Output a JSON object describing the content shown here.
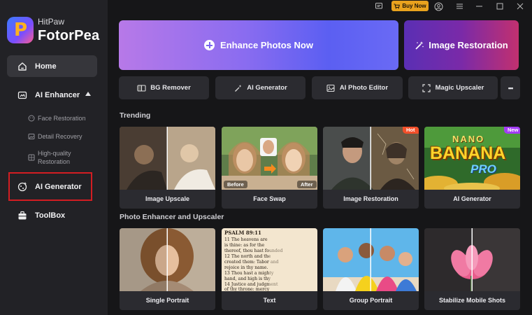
{
  "app": {
    "brand_small": "HitPaw",
    "brand_name": "FotorPea"
  },
  "titlebar": {
    "buy_now": "Buy Now"
  },
  "sidebar": {
    "home": "Home",
    "ai_enhancer": "AI Enhancer",
    "sub_items": [
      "Face Restoration",
      "Detail Recovery",
      "High-quality",
      "Restoration"
    ],
    "ai_generator": "AI Generator",
    "toolbox": "ToolBox"
  },
  "hero": {
    "enhance": "Enhance Photos Now",
    "restoration": "Image Restoration"
  },
  "tools": [
    "BG Remover",
    "AI Generator",
    "AI Photo Editor",
    "Magic Upscaler",
    "•••"
  ],
  "sections": {
    "trending": "Trending",
    "enhancer": "Photo Enhancer and Upscaler"
  },
  "trending_cards": [
    {
      "label": "Image Upscale"
    },
    {
      "label": "Face Swap",
      "before": "Before",
      "after": "After"
    },
    {
      "label": "Image Restoration",
      "badge": "Hot"
    },
    {
      "label": "AI Generator",
      "badge": "New",
      "art_line1": "NANO",
      "art_line2": "BANANA",
      "art_line3": "PRO"
    }
  ],
  "enhancer_cards": [
    {
      "label": "Single Portrait"
    },
    {
      "label": "Text",
      "header": "PSALM 89:11",
      "lines": [
        "11 The heavens are",
        "is thine: as for the",
        "thereof, thou hast founded",
        "12 The north and the",
        "created them: Tabor and",
        "rejoice in thy name.",
        "13 Thou hast a mighty",
        "hand, and high is thy",
        "14 Justice and judgment",
        "of thy throne: mercy"
      ]
    },
    {
      "label": "Group Portrait"
    },
    {
      "label": "Stabilize Mobile Shots"
    }
  ],
  "colors": {
    "accent_red": "#d31d22",
    "buy_now": "#e9a21e",
    "hot": "#f24f2a",
    "new": "#a33cf5"
  }
}
